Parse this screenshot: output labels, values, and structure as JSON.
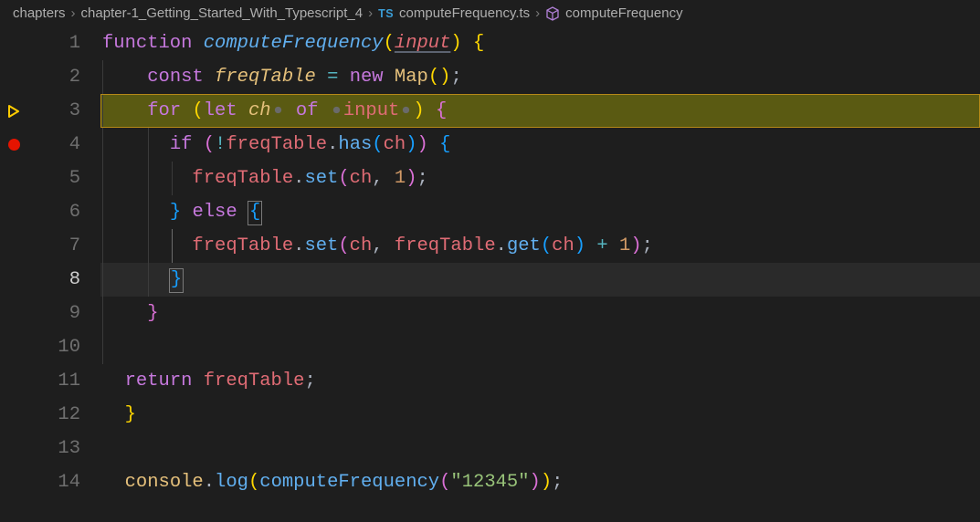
{
  "breadcrumbs": {
    "root": "chapters",
    "folder": "chapter-1_Getting_Started_With_Typescript_4",
    "ts_badge": "TS",
    "file": "computeFrequency.ts",
    "symbol": "computeFrequency"
  },
  "gutter": {
    "lines": [
      "1",
      "2",
      "3",
      "4",
      "5",
      "6",
      "7",
      "8",
      "9",
      "10",
      "11",
      "12",
      "13",
      "14"
    ]
  },
  "code": {
    "l1": {
      "kw_function": "function",
      "fn": "computeFrequency",
      "param": "input"
    },
    "l2": {
      "kw_const": "const",
      "var": "freqTable",
      "kw_new": "new",
      "cls": "Map"
    },
    "l3": {
      "kw_for": "for",
      "kw_let": "let",
      "var": "ch",
      "kw_of": "of",
      "src": "input"
    },
    "l4": {
      "kw_if": "if",
      "tbl": "freqTable",
      "has": "has",
      "arg": "ch"
    },
    "l5": {
      "tbl": "freqTable",
      "set": "set",
      "arg1": "ch",
      "arg2": "1"
    },
    "l6": {
      "kw_else": "else"
    },
    "l7": {
      "tbl": "freqTable",
      "set": "set",
      "arg1": "ch",
      "tbl2": "freqTable",
      "get": "get",
      "arg2": "ch",
      "plus": "+",
      "one": "1"
    },
    "l11": {
      "kw_return": "return",
      "var": "freqTable"
    },
    "l14": {
      "obj": "console",
      "log": "log",
      "fn": "computeFrequency",
      "str": "\"12345\""
    }
  },
  "colors": {
    "background": "#1e1e1e",
    "exec_highlight": "#5a5a12",
    "breakpoint": "#e51400"
  }
}
